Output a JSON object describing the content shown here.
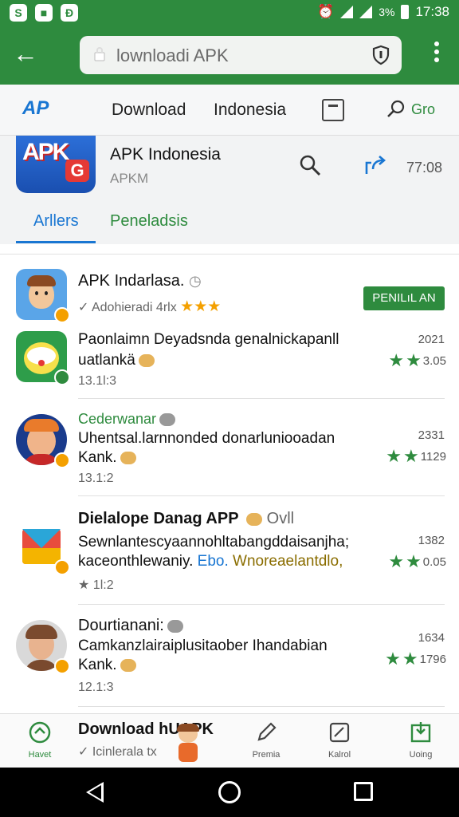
{
  "status_bar": {
    "notification_icons": [
      "S",
      "■",
      "Ɖ"
    ],
    "battery": "3%",
    "time": "17:38"
  },
  "browser": {
    "url_text": "lownloadi APK"
  },
  "site_nav": {
    "logo": "AP",
    "links": [
      "Download",
      "Indonesia"
    ],
    "search_label": "Gro"
  },
  "app_header": {
    "title": "APK Indonesia",
    "subtitle": "APKM",
    "time": "77:08",
    "logo_text": "APK",
    "logo_badge": "G",
    "tabs": [
      "Arllers",
      "Peneladsis"
    ]
  },
  "list": {
    "items": [
      {
        "title": "APK Indarlasa.",
        "meta": "Adohieradi 4rlx",
        "button": "PENILıL AN",
        "icon_colors": [
          "#5aa5e8",
          "#f2c79b"
        ]
      },
      {
        "text_line1": "Paonlaimn Deyadsnda genalnickapanll",
        "text_line2": "uatlankä",
        "meta": "13.1l:3",
        "year": "2021",
        "rating": "3.05",
        "icon_colors": [
          "#2e9d4a",
          "#f7e04b"
        ]
      },
      {
        "title": "Cederwanar",
        "text_line1": "Uhentsal.larnnonded donarluniooadan",
        "text_line2": "Kank.",
        "meta": "13.1:2",
        "year": "2331",
        "rating": "1129",
        "icon_colors": [
          "#1a3b8c",
          "#e97b2b"
        ]
      },
      {
        "title": "Dielalope Danag APP",
        "title_suffix": "Ovll",
        "text_line1": "Sewnlantescyaannohltabangddaisanjha;",
        "text_line2a": "kaceonthlewaniy.",
        "text_line2b": "Ebo.",
        "text_line2c": "Wnoreaelantdlo,",
        "meta": "1l:2",
        "year": "1382",
        "rating": "0.05",
        "icon_colors": [
          "#e84c3d",
          "#2aa6d8"
        ]
      },
      {
        "title": "Dourtianani:",
        "text_line1": "Camkanzlairaiplusitaober Ihandabian",
        "text_line2": "Kank.",
        "meta": "12.1:3",
        "year": "1634",
        "rating": "1796",
        "icon_colors": [
          "#d9d9d9",
          "#7a4a2e"
        ]
      }
    ]
  },
  "bottom_nav": {
    "items": [
      "Havet",
      "Premia",
      "Kalrol",
      "Uoing"
    ],
    "center_title": "Download hUAPK",
    "center_sub": "Icinlerala tx"
  },
  "colors": {
    "primary_green": "#2e8b3e",
    "accent_blue": "#1976d2"
  }
}
